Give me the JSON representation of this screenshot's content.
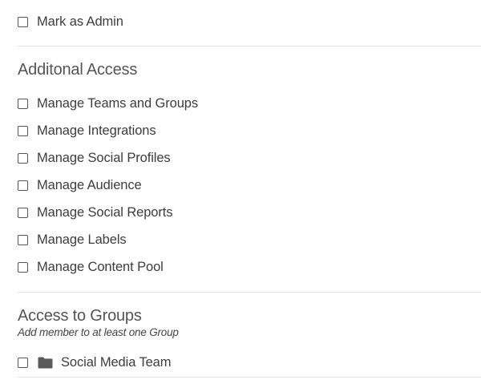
{
  "admin": {
    "label": "Mark as Admin",
    "checked": false
  },
  "additional_access": {
    "title": "Additonal Access",
    "items": [
      {
        "label": "Manage Teams and Groups",
        "checked": false
      },
      {
        "label": "Manage Integrations",
        "checked": false
      },
      {
        "label": "Manage Social Profiles",
        "checked": false
      },
      {
        "label": "Manage Audience",
        "checked": false
      },
      {
        "label": "Manage Social Reports",
        "checked": false
      },
      {
        "label": "Manage Labels",
        "checked": false
      },
      {
        "label": "Manage Content Pool",
        "checked": false
      }
    ]
  },
  "groups": {
    "title": "Access to Groups",
    "subtitle": "Add member to at least one Group",
    "items": [
      {
        "label": "Social Media Team",
        "icon": "folder-icon",
        "checked": false
      }
    ]
  }
}
